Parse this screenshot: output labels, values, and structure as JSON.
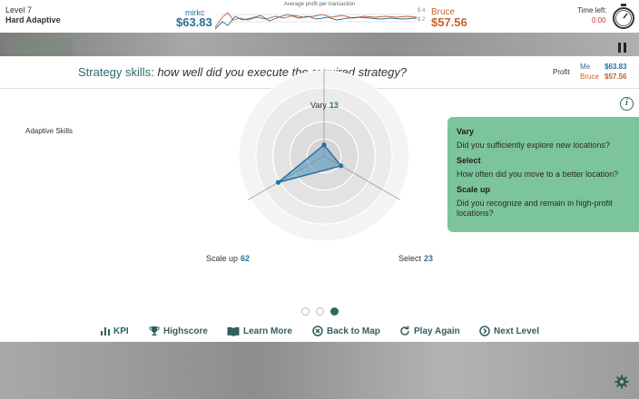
{
  "header": {
    "level": "Level 7",
    "mode": "Hard Adaptive",
    "me_name": "mirkc",
    "me_value": "$63.83",
    "chart_title": "Average profit per transaction",
    "tick_top": "$ 4",
    "tick_bottom": "$ 2",
    "opponent_name": "Bruce",
    "opponent_value": "$57.56",
    "time_label": "Time left:",
    "time_value": "0:00"
  },
  "panel": {
    "title_prefix": "Strategy skills:",
    "title_question": "how well did you execute the required strategy?",
    "profit_label": "Profit",
    "profit_me_name": "Me",
    "profit_me_value": "$63.83",
    "profit_opp_name": "Bruce",
    "profit_opp_value": "$57.56",
    "section_label": "Adaptive Skills"
  },
  "radar": {
    "axes": [
      {
        "name": "Vary",
        "value": "13"
      },
      {
        "name": "Select",
        "value": "23"
      },
      {
        "name": "Scale up",
        "value": "62"
      }
    ],
    "max": 100,
    "fill_color": "#4a90c0",
    "stroke_color": "#2c6f9e"
  },
  "info": {
    "items": [
      {
        "heading": "Vary",
        "text": "Did you sufficiently explore new locations?"
      },
      {
        "heading": "Select",
        "text": "How often did you move to a better location?"
      },
      {
        "heading": "Scale up",
        "text": "Did you recognize and remain in high-profit locations?"
      }
    ]
  },
  "pager": {
    "count": 3,
    "active": 2
  },
  "buttons": {
    "kpi": "KPI",
    "highscore": "Highscore",
    "learn_more": "Learn More",
    "back_to_map": "Back to Map",
    "play_again": "Play Again",
    "next_level": "Next Level"
  },
  "colors": {
    "me": "#2e6f95",
    "opponent": "#c4622d",
    "accent": "#2f5f5f",
    "info_card": "#7cc49c"
  }
}
